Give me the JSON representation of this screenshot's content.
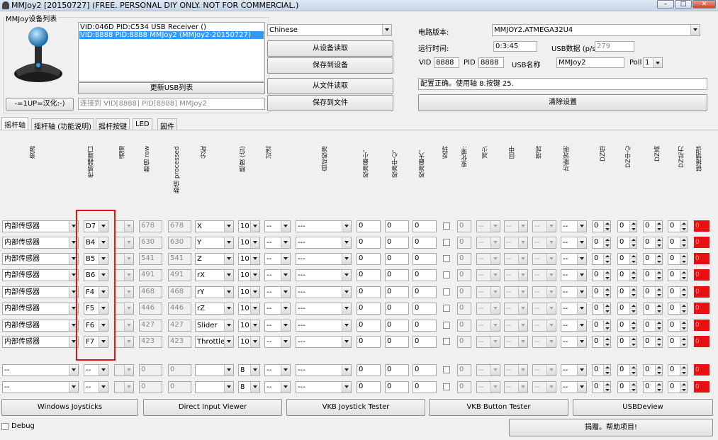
{
  "window": {
    "title": "MMJoy2 [20150727] (FREE. PERSONAL DIY ONLY. NOT FOR COMMERCIAL.)",
    "min": "–",
    "max": "□",
    "close": "✕"
  },
  "left": {
    "group_title": "MMJoy设备列表",
    "devices": [
      "VID:046D PID:C534 USB Receiver ()",
      "VID:8888 PID:8888 MMJoy2 (MMJoy2-20150727)"
    ],
    "refresh": "更新USB列表",
    "lang_btn": "-=1UP=汉化:-)",
    "connected": "连接到 VID[8888] PID[8888] MMJoy2"
  },
  "mid": {
    "language": "Chinese",
    "read_dev": "从设备读取",
    "save_dev": "保存到设备",
    "read_file": "从文件读取",
    "save_file": "保存到文件"
  },
  "right": {
    "board_label": "电路版本:",
    "board": "MMJOY2.ATMEGA32U4",
    "uptime_label": "运行时间:",
    "uptime": "0:3:45",
    "usbrate_label": "USB数据 (p/s)",
    "usbrate": "279",
    "vid_label": "VID",
    "vid": "8888",
    "pid_label": "PID",
    "pid": "8888",
    "usbname_label": "USB名称",
    "usbname": "MMJoy2",
    "poll_label": "Poll",
    "poll": "1",
    "status": "配置正确。使用轴 8.按键 25.",
    "clear": "清除设置"
  },
  "tabs": [
    "摇杆轴",
    "摇杆轴 (功能说明)",
    "摇杆按键",
    "LED",
    "固件"
  ],
  "headers": [
    "资源",
    "传感器端口",
    "通道",
    "数值 row",
    "数值 processed",
    "分配",
    "精度 (位)",
    "过滤",
    "自动校准",
    "校准最小。",
    "校准中心。",
    "校准最大。",
    "反转",
    "变化率:",
    "减少",
    "回中",
    "增加",
    "功能说明",
    "DZ低",
    "DZ中心",
    "DZ高",
    "DZ动力",
    "链接错误"
  ],
  "rows": [
    {
      "src": "内部传感器",
      "port": "D7",
      "ch": "",
      "raw": "678",
      "proc": "678",
      "assign": "X",
      "bits": "10",
      "filter": "--",
      "auto": "---",
      "min": "0",
      "center": "0",
      "max": "0",
      "rate": "0",
      "dec": "--",
      "mid": "--",
      "inc": "--",
      "func": "--",
      "dzl": "0",
      "dzc": "0",
      "dzh": "0",
      "dzp": "0",
      "err": "0"
    },
    {
      "src": "内部传感器",
      "port": "B4",
      "ch": "",
      "raw": "630",
      "proc": "630",
      "assign": "Y",
      "bits": "10",
      "filter": "--",
      "auto": "---",
      "min": "0",
      "center": "0",
      "max": "0",
      "rate": "0",
      "dec": "--",
      "mid": "--",
      "inc": "--",
      "func": "--",
      "dzl": "0",
      "dzc": "0",
      "dzh": "0",
      "dzp": "0",
      "err": "0"
    },
    {
      "src": "内部传感器",
      "port": "B5",
      "ch": "",
      "raw": "541",
      "proc": "541",
      "assign": "Z",
      "bits": "10",
      "filter": "--",
      "auto": "---",
      "min": "0",
      "center": "0",
      "max": "0",
      "rate": "0",
      "dec": "--",
      "mid": "--",
      "inc": "--",
      "func": "--",
      "dzl": "0",
      "dzc": "0",
      "dzh": "0",
      "dzp": "0",
      "err": "0"
    },
    {
      "src": "内部传感器",
      "port": "B6",
      "ch": "",
      "raw": "491",
      "proc": "491",
      "assign": "rX",
      "bits": "10",
      "filter": "--",
      "auto": "---",
      "min": "0",
      "center": "0",
      "max": "0",
      "rate": "0",
      "dec": "--",
      "mid": "--",
      "inc": "--",
      "func": "--",
      "dzl": "0",
      "dzc": "0",
      "dzh": "0",
      "dzp": "0",
      "err": "0"
    },
    {
      "src": "内部传感器",
      "port": "F4",
      "ch": "",
      "raw": "468",
      "proc": "468",
      "assign": "rY",
      "bits": "10",
      "filter": "--",
      "auto": "---",
      "min": "0",
      "center": "0",
      "max": "0",
      "rate": "0",
      "dec": "--",
      "mid": "--",
      "inc": "--",
      "func": "--",
      "dzl": "0",
      "dzc": "0",
      "dzh": "0",
      "dzp": "0",
      "err": "0"
    },
    {
      "src": "内部传感器",
      "port": "F5",
      "ch": "",
      "raw": "446",
      "proc": "446",
      "assign": "rZ",
      "bits": "10",
      "filter": "--",
      "auto": "---",
      "min": "0",
      "center": "0",
      "max": "0",
      "rate": "0",
      "dec": "--",
      "mid": "--",
      "inc": "--",
      "func": "--",
      "dzl": "0",
      "dzc": "0",
      "dzh": "0",
      "dzp": "0",
      "err": "0"
    },
    {
      "src": "内部传感器",
      "port": "F6",
      "ch": "",
      "raw": "427",
      "proc": "427",
      "assign": "Slider",
      "bits": "10",
      "filter": "--",
      "auto": "---",
      "min": "0",
      "center": "0",
      "max": "0",
      "rate": "0",
      "dec": "--",
      "mid": "--",
      "inc": "--",
      "func": "--",
      "dzl": "0",
      "dzc": "0",
      "dzh": "0",
      "dzp": "0",
      "err": "0"
    },
    {
      "src": "内部传感器",
      "port": "F7",
      "ch": "",
      "raw": "423",
      "proc": "423",
      "assign": "Throttle",
      "bits": "10",
      "filter": "--",
      "auto": "---",
      "min": "0",
      "center": "0",
      "max": "0",
      "rate": "0",
      "dec": "--",
      "mid": "--",
      "inc": "--",
      "func": "--",
      "dzl": "0",
      "dzc": "0",
      "dzh": "0",
      "dzp": "0",
      "err": "0"
    },
    {
      "src": "--",
      "port": "--",
      "ch": "",
      "raw": "0",
      "proc": "0",
      "assign": "",
      "bits": "8",
      "filter": "--",
      "auto": "---",
      "min": "0",
      "center": "0",
      "max": "0",
      "rate": "0",
      "dec": "--",
      "mid": "--",
      "inc": "--",
      "func": "--",
      "dzl": "0",
      "dzc": "0",
      "dzh": "0",
      "dzp": "0",
      "err": "0"
    },
    {
      "src": "--",
      "port": "--",
      "ch": "",
      "raw": "0",
      "proc": "0",
      "assign": "",
      "bits": "8",
      "filter": "--",
      "auto": "---",
      "min": "0",
      "center": "0",
      "max": "0",
      "rate": "0",
      "dec": "--",
      "mid": "--",
      "inc": "--",
      "func": "--",
      "dzl": "0",
      "dzc": "0",
      "dzh": "0",
      "dzp": "0",
      "err": "0"
    }
  ],
  "bottom": {
    "b1": "Windows Joysticks",
    "b2": "Direct Input Viewer",
    "b3": "VKB Joystick Tester",
    "b4": "VKB Button Tester",
    "b5": "USBDeview",
    "debug": "Debug",
    "donate": "捐赠。帮助项目!"
  },
  "colors": {
    "highlight": "#e81010",
    "select": "#3399ff"
  }
}
